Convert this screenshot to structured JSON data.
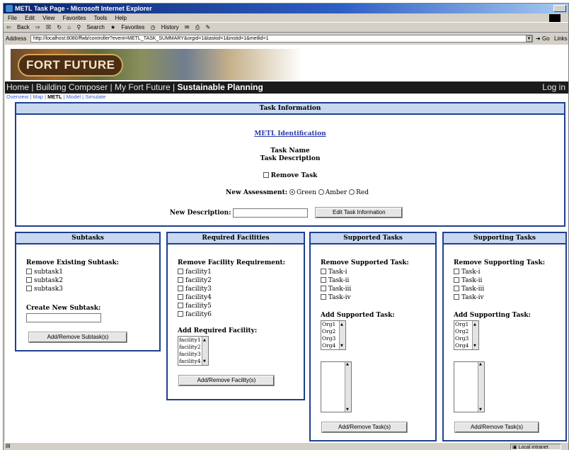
{
  "window": {
    "title": "METL Task Page - Microsoft Internet Explorer"
  },
  "menu": [
    "File",
    "Edit",
    "View",
    "Favorites",
    "Tools",
    "Help"
  ],
  "toolbar": {
    "back": "Back",
    "search": "Search",
    "favorites": "Favorites",
    "history": "History"
  },
  "address": {
    "label": "Address",
    "url": "http://localhost:8080/ffwb/controller?event=METL_TASK_SUMMARY&orgid=1&taskid=1&instid=1&metlid=1",
    "go": "Go",
    "links": "Links"
  },
  "banner": {
    "logo": "FORT FUTURE"
  },
  "nav": {
    "home": "Home",
    "building_composer": "Building Composer",
    "my_fort_future": "My Fort Future",
    "sustainable_planning": "Sustainable Planning",
    "login": "Log in"
  },
  "subnav": {
    "overview": "Overview",
    "map": "Map",
    "metl": "METL",
    "model": "Model",
    "simulate": "Simulate"
  },
  "task_info": {
    "header": "Task Information",
    "metl_identification": "METL Identification",
    "task_name": "Task Name",
    "task_description": "Task Description",
    "remove_task": "Remove Task",
    "new_assessment_label": "New Assessment:",
    "assessment_options": [
      "Green",
      "Amber",
      "Red"
    ],
    "assessment_selected": "Green",
    "new_description_label": "New Description:",
    "new_description_value": "",
    "edit_button": "Edit Task Information"
  },
  "subtasks": {
    "header": "Subtasks",
    "remove_label": "Remove Existing Subtask:",
    "items": [
      "subtask1",
      "subtask2",
      "subtask3"
    ],
    "create_label": "Create New Subtask:",
    "create_value": "",
    "button": "Add/Remove Subtask(s)"
  },
  "facilities": {
    "header": "Required Facilities",
    "remove_label": "Remove Facility Requirement:",
    "items": [
      "facility1",
      "facility2",
      "facility3",
      "facility4",
      "facility5",
      "facility6"
    ],
    "add_label": "Add Required Facility:",
    "options": [
      "facility1",
      "facility2",
      "facility3",
      "facility4"
    ],
    "button": "Add/Remove Facility(s)"
  },
  "supported": {
    "header": "Supported Tasks",
    "remove_label": "Remove Supported Task:",
    "items": [
      "Task-i",
      "Task-ii",
      "Task-iii",
      "Task-iv"
    ],
    "add_label": "Add Supported Task:",
    "options": [
      "Org1",
      "Org2",
      "Org3",
      "Org4"
    ],
    "button": "Add/Remove Task(s)"
  },
  "supporting": {
    "header": "Supporting Tasks",
    "remove_label": "Remove Supporting Task:",
    "items": [
      "Task-i",
      "Task-ii",
      "Task-iii",
      "Task-iv"
    ],
    "add_label": "Add Supporting Task:",
    "options": [
      "Org1",
      "Org2",
      "Org3",
      "Org4"
    ],
    "button": "Add/Remove Task(s)"
  },
  "status": {
    "zone": "Local intranet"
  }
}
